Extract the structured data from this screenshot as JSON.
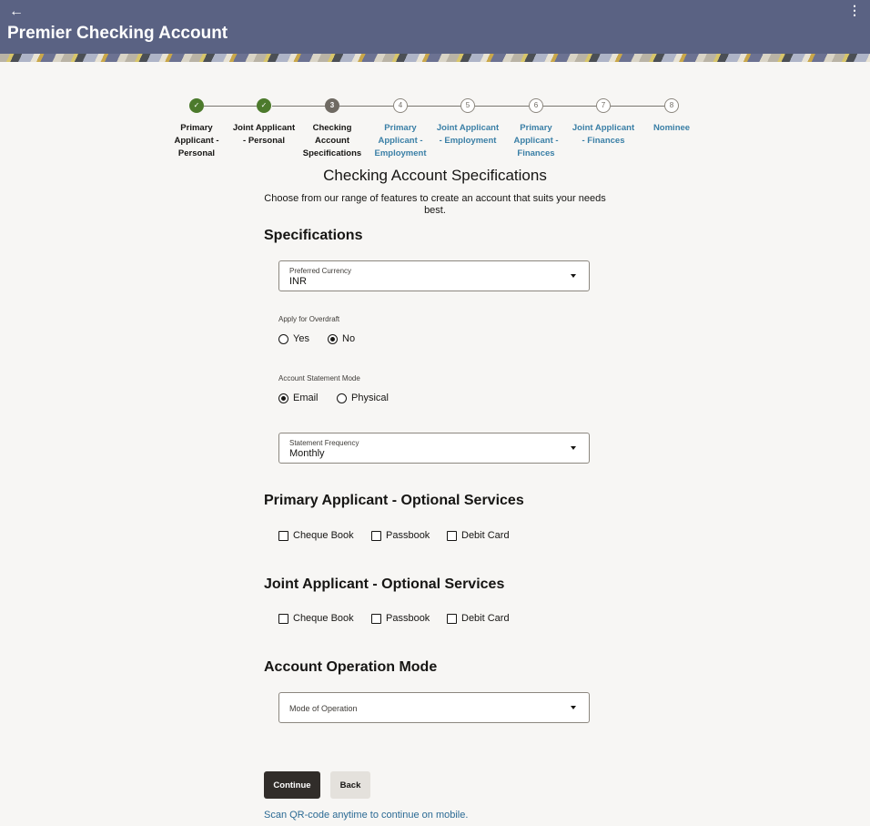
{
  "header": {
    "title": "Premier Checking Account",
    "back_icon": "←",
    "more_icon": "⋮"
  },
  "stepper": {
    "steps": [
      {
        "number": "✓",
        "label": "Primary Applicant - Personal",
        "state": "done"
      },
      {
        "number": "✓",
        "label": "Joint Applicant - Personal",
        "state": "done"
      },
      {
        "number": "3",
        "label": "Checking Account Specifications",
        "state": "current"
      },
      {
        "number": "4",
        "label": "Primary Applicant - Employment",
        "state": "todo"
      },
      {
        "number": "5",
        "label": "Joint Applicant - Employment",
        "state": "todo"
      },
      {
        "number": "6",
        "label": "Primary Applicant - Finances",
        "state": "todo"
      },
      {
        "number": "7",
        "label": "Joint Applicant - Finances",
        "state": "todo"
      },
      {
        "number": "8",
        "label": "Nominee",
        "state": "todo"
      }
    ]
  },
  "page": {
    "title": "Checking Account Specifications",
    "subtitle": "Choose from our range of features to create an account that suits your needs best."
  },
  "specifications": {
    "title": "Specifications",
    "preferred_currency": {
      "label": "Preferred Currency",
      "value": "INR"
    },
    "overdraft": {
      "label": "Apply for Overdraft",
      "options": [
        "Yes",
        "No"
      ],
      "selected": "No"
    },
    "statement_mode": {
      "label": "Account Statement Mode",
      "options": [
        "Email",
        "Physical"
      ],
      "selected": "Email"
    },
    "statement_frequency": {
      "label": "Statement Frequency",
      "value": "Monthly"
    }
  },
  "primary_services": {
    "title": "Primary Applicant - Optional Services",
    "options": [
      "Cheque Book",
      "Passbook",
      "Debit Card"
    ]
  },
  "joint_services": {
    "title": "Joint Applicant - Optional Services",
    "options": [
      "Cheque Book",
      "Passbook",
      "Debit Card"
    ]
  },
  "operation_mode": {
    "title": "Account Operation Mode",
    "placeholder": "Mode of Operation"
  },
  "actions": {
    "continue_label": "Continue",
    "back_label": "Back",
    "qr_text": "Scan QR-code anytime to continue on mobile."
  },
  "colors": {
    "header_bg": "#5a6283",
    "step_done": "#4c7a2c",
    "step_current": "#6f6a63",
    "link": "#3a7fa6",
    "primary_button": "#312d2a"
  }
}
